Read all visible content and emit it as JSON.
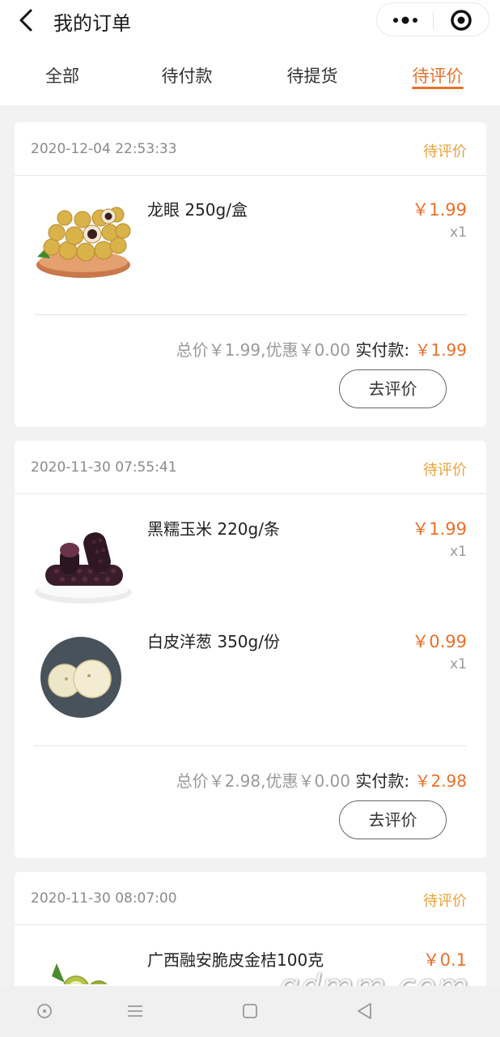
{
  "header": {
    "title": "我的订单"
  },
  "tabs": [
    {
      "label": "全部",
      "active": false
    },
    {
      "label": "待付款",
      "active": false
    },
    {
      "label": "待提货",
      "active": false
    },
    {
      "label": "待评价",
      "active": true
    }
  ],
  "orders": [
    {
      "datetime": "2020-12-04 22:53:33",
      "status": "待评价",
      "items": [
        {
          "name": "龙眼 250g/盒",
          "price": "￥1.99",
          "qty": "x1",
          "image": "longan"
        }
      ],
      "summary": "总价￥1.99,优惠￥0.00",
      "paid_label": "实付款:",
      "paid_value": "￥1.99",
      "action": "去评价"
    },
    {
      "datetime": "2020-11-30 07:55:41",
      "status": "待评价",
      "items": [
        {
          "name": "黑糯玉米 220g/条",
          "price": "￥1.99",
          "qty": "x1",
          "image": "black-corn"
        },
        {
          "name": "白皮洋葱 350g/份",
          "price": "￥0.99",
          "qty": "x1",
          "image": "white-onion"
        }
      ],
      "summary": "总价￥2.98,优惠￥0.00",
      "paid_label": "实付款:",
      "paid_value": "￥2.98",
      "action": "去评价"
    },
    {
      "datetime": "2020-11-30 08:07:00",
      "status": "待评价",
      "items": [
        {
          "name": "广西融安脆皮金桔100克",
          "price": "￥0.1",
          "image": "kumquat"
        }
      ]
    }
  ],
  "watermark": "gdmm.com",
  "colors": {
    "accent": "#e8702a",
    "status": "#e9a23b",
    "background": "#f2f2f2"
  },
  "icons": {
    "back": "chevron-left-icon",
    "more": "more-dots-icon",
    "target": "target-icon",
    "nav": [
      "circle-icon",
      "menu-icon",
      "square-icon",
      "triangle-back-icon"
    ]
  }
}
